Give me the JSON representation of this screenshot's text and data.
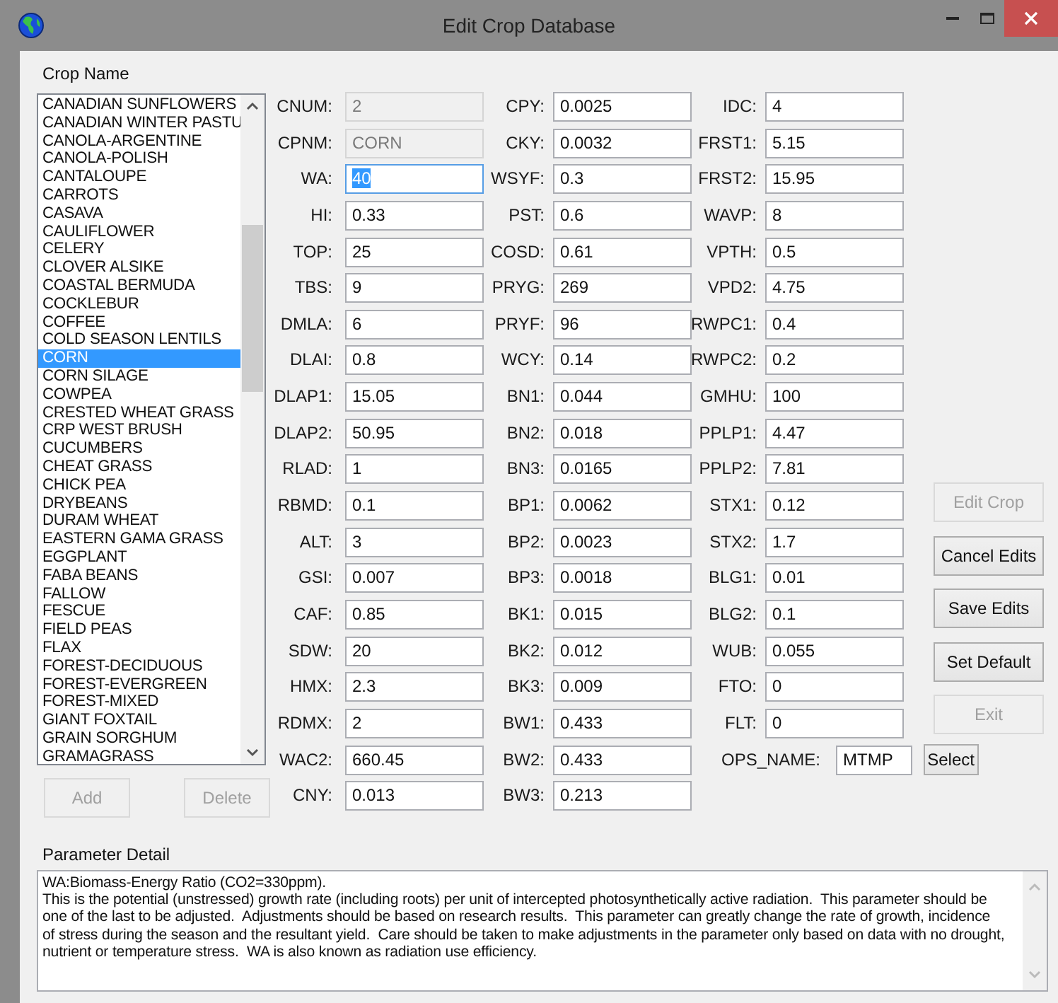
{
  "window": {
    "title": "Edit Crop Database"
  },
  "crop_list": {
    "label": "Crop Name",
    "items": [
      {
        "label": "CANADIAN SUNFLOWERS",
        "selected": false
      },
      {
        "label": "CANADIAN WINTER PASTU",
        "selected": false
      },
      {
        "label": "CANOLA-ARGENTINE",
        "selected": false
      },
      {
        "label": "CANOLA-POLISH",
        "selected": false
      },
      {
        "label": "CANTALOUPE",
        "selected": false
      },
      {
        "label": "CARROTS",
        "selected": false
      },
      {
        "label": "CASAVA",
        "selected": false
      },
      {
        "label": "CAULIFLOWER",
        "selected": false
      },
      {
        "label": "CELERY",
        "selected": false
      },
      {
        "label": "CLOVER ALSIKE",
        "selected": false
      },
      {
        "label": "COASTAL BERMUDA",
        "selected": false
      },
      {
        "label": "COCKLEBUR",
        "selected": false
      },
      {
        "label": "COFFEE",
        "selected": false
      },
      {
        "label": "COLD SEASON LENTILS",
        "selected": false
      },
      {
        "label": "CORN",
        "selected": true
      },
      {
        "label": "CORN SILAGE",
        "selected": false
      },
      {
        "label": "COWPEA",
        "selected": false
      },
      {
        "label": "CRESTED WHEAT GRASS",
        "selected": false
      },
      {
        "label": "CRP WEST BRUSH",
        "selected": false
      },
      {
        "label": "CUCUMBERS",
        "selected": false
      },
      {
        "label": "CHEAT GRASS",
        "selected": false
      },
      {
        "label": "CHICK PEA",
        "selected": false
      },
      {
        "label": "DRYBEANS",
        "selected": false
      },
      {
        "label": "DURAM WHEAT",
        "selected": false
      },
      {
        "label": "EASTERN GAMA GRASS",
        "selected": false
      },
      {
        "label": "EGGPLANT",
        "selected": false
      },
      {
        "label": "FABA BEANS",
        "selected": false
      },
      {
        "label": "FALLOW",
        "selected": false
      },
      {
        "label": "FESCUE",
        "selected": false
      },
      {
        "label": "FIELD PEAS",
        "selected": false
      },
      {
        "label": "FLAX",
        "selected": false
      },
      {
        "label": "FOREST-DECIDUOUS",
        "selected": false
      },
      {
        "label": "FOREST-EVERGREEN",
        "selected": false
      },
      {
        "label": "FOREST-MIXED",
        "selected": false
      },
      {
        "label": "GIANT FOXTAIL",
        "selected": false
      },
      {
        "label": "GRAIN SORGHUM",
        "selected": false
      },
      {
        "label": "GRAMAGRASS",
        "selected": false
      }
    ]
  },
  "list_buttons": [
    {
      "label": "Add",
      "disabled": true
    },
    {
      "label": "Delete",
      "disabled": true
    }
  ],
  "parameter_columns": [
    [
      {
        "label": "CNUM:",
        "value": "2",
        "disabled": true,
        "highlighted": false
      },
      {
        "label": "CPNM:",
        "value": "CORN",
        "disabled": true,
        "highlighted": false
      },
      {
        "label": "WA:",
        "value": "40",
        "disabled": false,
        "highlighted": true
      },
      {
        "label": "HI:",
        "value": "0.33",
        "disabled": false,
        "highlighted": false
      },
      {
        "label": "TOP:",
        "value": "25",
        "disabled": false,
        "highlighted": false
      },
      {
        "label": "TBS:",
        "value": "9",
        "disabled": false,
        "highlighted": false
      },
      {
        "label": "DMLA:",
        "value": "6",
        "disabled": false,
        "highlighted": false
      },
      {
        "label": "DLAI:",
        "value": "0.8",
        "disabled": false,
        "highlighted": false
      },
      {
        "label": "DLAP1:",
        "value": "15.05",
        "disabled": false,
        "highlighted": false
      },
      {
        "label": "DLAP2:",
        "value": "50.95",
        "disabled": false,
        "highlighted": false
      },
      {
        "label": "RLAD:",
        "value": "1",
        "disabled": false,
        "highlighted": false
      },
      {
        "label": "RBMD:",
        "value": "0.1",
        "disabled": false,
        "highlighted": false
      },
      {
        "label": "ALT:",
        "value": "3",
        "disabled": false,
        "highlighted": false
      },
      {
        "label": "GSI:",
        "value": "0.007",
        "disabled": false,
        "highlighted": false
      },
      {
        "label": "CAF:",
        "value": "0.85",
        "disabled": false,
        "highlighted": false
      },
      {
        "label": "SDW:",
        "value": "20",
        "disabled": false,
        "highlighted": false
      },
      {
        "label": "HMX:",
        "value": "2.3",
        "disabled": false,
        "highlighted": false
      },
      {
        "label": "RDMX:",
        "value": "2",
        "disabled": false,
        "highlighted": false
      },
      {
        "label": "WAC2:",
        "value": "660.45",
        "disabled": false,
        "highlighted": false
      },
      {
        "label": "CNY:",
        "value": "0.013",
        "disabled": false,
        "highlighted": false
      }
    ],
    [
      {
        "label": "CPY:",
        "value": "0.0025",
        "disabled": false,
        "highlighted": false
      },
      {
        "label": "CKY:",
        "value": "0.0032",
        "disabled": false,
        "highlighted": false
      },
      {
        "label": "WSYF:",
        "value": "0.3",
        "disabled": false,
        "highlighted": false
      },
      {
        "label": "PST:",
        "value": "0.6",
        "disabled": false,
        "highlighted": false
      },
      {
        "label": "COSD:",
        "value": "0.61",
        "disabled": false,
        "highlighted": false
      },
      {
        "label": "PRYG:",
        "value": "269",
        "disabled": false,
        "highlighted": false
      },
      {
        "label": "PRYF:",
        "value": "96",
        "disabled": false,
        "highlighted": false
      },
      {
        "label": "WCY:",
        "value": "0.14",
        "disabled": false,
        "highlighted": false
      },
      {
        "label": "BN1:",
        "value": "0.044",
        "disabled": false,
        "highlighted": false
      },
      {
        "label": "BN2:",
        "value": "0.018",
        "disabled": false,
        "highlighted": false
      },
      {
        "label": "BN3:",
        "value": "0.0165",
        "disabled": false,
        "highlighted": false
      },
      {
        "label": "BP1:",
        "value": "0.0062",
        "disabled": false,
        "highlighted": false
      },
      {
        "label": "BP2:",
        "value": "0.0023",
        "disabled": false,
        "highlighted": false
      },
      {
        "label": "BP3:",
        "value": "0.0018",
        "disabled": false,
        "highlighted": false
      },
      {
        "label": "BK1:",
        "value": "0.015",
        "disabled": false,
        "highlighted": false
      },
      {
        "label": "BK2:",
        "value": "0.012",
        "disabled": false,
        "highlighted": false
      },
      {
        "label": "BK3:",
        "value": "0.009",
        "disabled": false,
        "highlighted": false
      },
      {
        "label": "BW1:",
        "value": "0.433",
        "disabled": false,
        "highlighted": false
      },
      {
        "label": "BW2:",
        "value": "0.433",
        "disabled": false,
        "highlighted": false
      },
      {
        "label": "BW3:",
        "value": "0.213",
        "disabled": false,
        "highlighted": false
      }
    ],
    [
      {
        "label": "IDC:",
        "value": "4",
        "disabled": false,
        "highlighted": false
      },
      {
        "label": "FRST1:",
        "value": "5.15",
        "disabled": false,
        "highlighted": false
      },
      {
        "label": "FRST2:",
        "value": "15.95",
        "disabled": false,
        "highlighted": false
      },
      {
        "label": "WAVP:",
        "value": "8",
        "disabled": false,
        "highlighted": false
      },
      {
        "label": "VPTH:",
        "value": "0.5",
        "disabled": false,
        "highlighted": false
      },
      {
        "label": "VPD2:",
        "value": "4.75",
        "disabled": false,
        "highlighted": false
      },
      {
        "label": "RWPC1:",
        "value": "0.4",
        "disabled": false,
        "highlighted": false
      },
      {
        "label": "RWPC2:",
        "value": "0.2",
        "disabled": false,
        "highlighted": false
      },
      {
        "label": "GMHU:",
        "value": "100",
        "disabled": false,
        "highlighted": false
      },
      {
        "label": "PPLP1:",
        "value": "4.47",
        "disabled": false,
        "highlighted": false
      },
      {
        "label": "PPLP2:",
        "value": "7.81",
        "disabled": false,
        "highlighted": false
      },
      {
        "label": "STX1:",
        "value": "0.12",
        "disabled": false,
        "highlighted": false
      },
      {
        "label": "STX2:",
        "value": "1.7",
        "disabled": false,
        "highlighted": false
      },
      {
        "label": "BLG1:",
        "value": "0.01",
        "disabled": false,
        "highlighted": false
      },
      {
        "label": "BLG2:",
        "value": "0.1",
        "disabled": false,
        "highlighted": false
      },
      {
        "label": "WUB:",
        "value": "0.055",
        "disabled": false,
        "highlighted": false
      },
      {
        "label": "FTO:",
        "value": "0",
        "disabled": false,
        "highlighted": false
      },
      {
        "label": "FLT:",
        "value": "0",
        "disabled": false,
        "highlighted": false
      }
    ]
  ],
  "ops_name": {
    "label": "OPS_NAME:",
    "value": "MTMP",
    "button": "Select"
  },
  "action_buttons": [
    {
      "label": "Edit Crop",
      "disabled": true
    },
    {
      "label": "Cancel Edits",
      "disabled": false
    },
    {
      "label": "Save Edits",
      "disabled": false
    },
    {
      "label": "Set Default",
      "disabled": false
    },
    {
      "label": "Exit",
      "disabled": true
    }
  ],
  "parameter_detail": {
    "label": "Parameter Detail",
    "text": "WA:Biomass-Energy Ratio (CO2=330ppm).\nThis is the potential (unstressed) growth rate (including roots) per unit of intercepted photosynthetically active radiation.  This parameter should be\none of the last to be adjusted.  Adjustments should be based on research results.  This parameter can greatly change the rate of growth, incidence\nof stress during the season and the resultant yield.  Care should be taken to make adjustments in the parameter only based on data with no drought,\nnutrient or temperature stress.  WA is also known as radiation use efficiency."
  }
}
